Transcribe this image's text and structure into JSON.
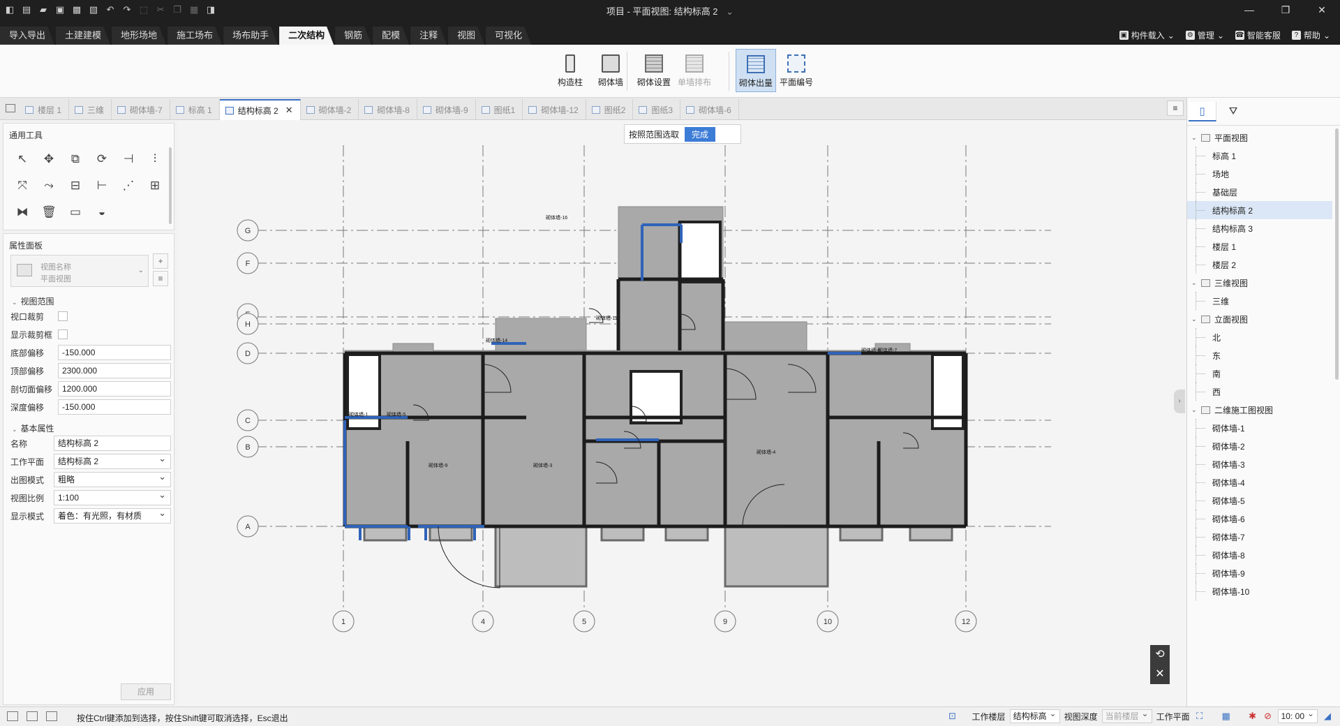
{
  "window": {
    "title": "项目 - 平面视图: 结构标高 2",
    "title_dropdown": "⌄"
  },
  "quick_access": [
    {
      "name": "app-logo-icon",
      "glyph": "◧"
    },
    {
      "name": "new-file-icon",
      "glyph": "▤"
    },
    {
      "name": "open-folder-icon",
      "glyph": "▰"
    },
    {
      "name": "save-icon",
      "glyph": "▣"
    },
    {
      "name": "save-as-icon",
      "glyph": "▩"
    },
    {
      "name": "export-icon",
      "glyph": "▧"
    },
    {
      "name": "undo-icon",
      "glyph": "↶"
    },
    {
      "name": "redo-icon",
      "glyph": "↷"
    },
    {
      "name": "select-icon",
      "glyph": "⬚",
      "dim": true
    },
    {
      "name": "cut-icon",
      "glyph": "✂",
      "dim": true
    },
    {
      "name": "copy-icon",
      "glyph": "❐",
      "dim": true
    },
    {
      "name": "paste-icon",
      "glyph": "▦",
      "dim": true
    },
    {
      "name": "cube-icon",
      "glyph": "◨"
    }
  ],
  "menu_tabs": [
    "导入导出",
    "土建建模",
    "地形场地",
    "施工场布",
    "场布助手",
    "二次结构",
    "钢筋",
    "配模",
    "注释",
    "视图",
    "可视化"
  ],
  "active_menu_tab": "二次结构",
  "menu_right": [
    {
      "name": "component-load",
      "icon": "▣",
      "label": "构件载入",
      "dropdown": "⌄"
    },
    {
      "name": "manage",
      "icon": "⚙",
      "label": "管理",
      "dropdown": "⌄"
    },
    {
      "name": "smart-service",
      "icon": "☎",
      "label": "智能客服"
    },
    {
      "name": "help",
      "icon": "?",
      "label": "帮助",
      "dropdown": "⌄"
    }
  ],
  "ribbon": {
    "group1": [
      {
        "name": "construction-column-button",
        "label": "构造柱",
        "icon": "col"
      },
      {
        "name": "masonry-wall-button",
        "label": "砌体墙",
        "icon": "wall"
      }
    ],
    "group2": [
      {
        "name": "masonry-settings-button",
        "label": "砌体设置",
        "icon": "brick"
      },
      {
        "name": "single-wall-layout-button",
        "label": "单墙排布",
        "icon": "brick dis",
        "disabled": true
      }
    ],
    "group3": [
      {
        "name": "masonry-output-button",
        "label": "砌体出量",
        "icon": "brick blue",
        "active": true
      },
      {
        "name": "plan-numbering-button",
        "label": "平面编号",
        "icon": "num"
      }
    ]
  },
  "view_tabs": [
    "楼层 1",
    "三维",
    "砌体墙-7",
    "标高 1",
    "结构标高 2",
    "砌体墙-2",
    "砌体墙-8",
    "砌体墙-9",
    "图纸1",
    "砌体墙-12",
    "图纸2",
    "图纸3",
    "砌体墙-6"
  ],
  "active_view_tab": "结构标高 2",
  "view_tabs_menu": "≡",
  "tools_panel": {
    "title": "通用工具",
    "tools": [
      {
        "name": "select-arrow-icon",
        "glyph": "↖"
      },
      {
        "name": "move-icon",
        "glyph": "✥"
      },
      {
        "name": "copy-element-icon",
        "glyph": "⧉"
      },
      {
        "name": "rotate-icon",
        "glyph": "⟳"
      },
      {
        "name": "align-icon",
        "glyph": "⊣"
      },
      {
        "name": "offset-icon",
        "glyph": "⫶"
      },
      {
        "name": "trim-icon",
        "glyph": "⤧"
      },
      {
        "name": "extend-icon",
        "glyph": "⤳"
      },
      {
        "name": "split-icon",
        "glyph": "⊟"
      },
      {
        "name": "break-icon",
        "glyph": "⊢"
      },
      {
        "name": "array-linear-icon",
        "glyph": "⋰"
      },
      {
        "name": "array-grid-icon",
        "glyph": "⊞"
      },
      {
        "name": "mirror-icon",
        "glyph": "⧓"
      },
      {
        "name": "delete-icon",
        "glyph": "🗑"
      },
      {
        "name": "measure-icon",
        "glyph": "▭"
      },
      {
        "name": "angle-measure-icon",
        "glyph": "◒"
      }
    ]
  },
  "properties": {
    "title": "属性面板",
    "type_line1": "视图名称",
    "type_line2": "平面视图",
    "add_glyph": "+",
    "edit_glyph": "≡",
    "section_view_range": "视图范围",
    "viewport_crop_label": "视口裁剪",
    "show_crop_label": "显示裁剪框",
    "bottom_offset_label": "底部偏移",
    "bottom_offset_value": "-150.000",
    "top_offset_label": "顶部偏移",
    "top_offset_value": "2300.000",
    "cut_offset_label": "剖切面偏移",
    "cut_offset_value": "1200.000",
    "depth_offset_label": "深度偏移",
    "depth_offset_value": "-150.000",
    "section_basic": "基本属性",
    "name_label": "名称",
    "name_value": "结构标高 2",
    "workplane_label": "工作平面",
    "workplane_value": "结构标高 2",
    "output_mode_label": "出图模式",
    "output_mode_value": "粗略",
    "scale_label": "视图比例",
    "scale_value": "1:100",
    "display_mode_label": "显示模式",
    "display_mode_value": "着色：有光照，有材质",
    "apply_label": "应用"
  },
  "canvas": {
    "select_range_label": "按照范围选取",
    "done_label": "完成",
    "grid_rows": [
      "G",
      "F",
      "E",
      "H",
      "D",
      "C",
      "B",
      "A"
    ],
    "grid_cols": [
      "1",
      "4",
      "5",
      "9",
      "10",
      "12"
    ],
    "wall_tags": [
      "砌体墙-1",
      "砌体墙-5",
      "砌体墙-14",
      "砌体墙-16",
      "砌体墙-11",
      "砌体墙-7",
      "砌体墙-6",
      "砌体墙-9",
      "砌体墙-4",
      "砌体墙-3"
    ],
    "reset_view_glyph": "⟲",
    "close_glyph": "✕",
    "expander_glyph": "›"
  },
  "right_panel": {
    "tab1_glyph": "▯",
    "tab2_glyph": "⛛",
    "tree": [
      {
        "label": "平面视图",
        "level": 0,
        "icon": "plan"
      },
      {
        "label": "标高 1",
        "level": 1
      },
      {
        "label": "场地",
        "level": 1
      },
      {
        "label": "基础层",
        "level": 1
      },
      {
        "label": "结构标高 2",
        "level": 1,
        "selected": true
      },
      {
        "label": "结构标高 3",
        "level": 1
      },
      {
        "label": "楼层 1",
        "level": 1
      },
      {
        "label": "楼层 2",
        "level": 1
      },
      {
        "label": "三维视图",
        "level": 0,
        "icon": "3d"
      },
      {
        "label": "三维",
        "level": 1
      },
      {
        "label": "立面视图",
        "level": 0,
        "icon": "elev"
      },
      {
        "label": "北",
        "level": 1
      },
      {
        "label": "东",
        "level": 1
      },
      {
        "label": "南",
        "level": 1
      },
      {
        "label": "西",
        "level": 1
      },
      {
        "label": "二维施工图视图",
        "level": 0,
        "icon": "sheet"
      },
      {
        "label": "砌体墙-1",
        "level": 1
      },
      {
        "label": "砌体墙-2",
        "level": 1
      },
      {
        "label": "砌体墙-3",
        "level": 1
      },
      {
        "label": "砌体墙-4",
        "level": 1
      },
      {
        "label": "砌体墙-5",
        "level": 1
      },
      {
        "label": "砌体墙-6",
        "level": 1
      },
      {
        "label": "砌体墙-7",
        "level": 1
      },
      {
        "label": "砌体墙-8",
        "level": 1
      },
      {
        "label": "砌体墙-9",
        "level": 1
      },
      {
        "label": "砌体墙-10",
        "level": 1
      }
    ]
  },
  "statusbar": {
    "hint": "按住Ctrl键添加到选择，按住Shift键可取消选择，Esc退出",
    "work_floor_label": "工作楼层",
    "work_floor_value": "结构标高",
    "view_depth_label": "视图深度",
    "view_depth_value": "当前楼层",
    "workplane_label": "工作平面",
    "time_value": "10: 00"
  },
  "colors": {
    "accent": "#3a72c4",
    "titlebar": "#1f1f1f",
    "wall_gray": "#a9a9a9",
    "wall_blue": "#2f63b8"
  }
}
